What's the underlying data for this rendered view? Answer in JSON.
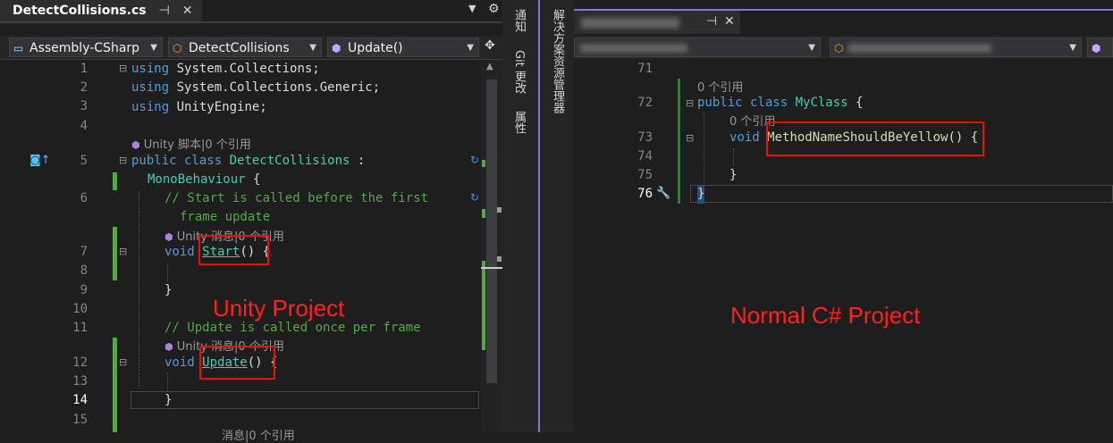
{
  "left_editor": {
    "tab_title": "DetectCollisions.cs",
    "nav": {
      "project": "Assembly-CSharp",
      "class": "DetectCollisions",
      "member": "Update()"
    },
    "line_numbers": [
      "1",
      "2",
      "3",
      "4",
      "5",
      "6",
      "7",
      "8",
      "9",
      "10",
      "11",
      "12",
      "13",
      "14",
      "15"
    ],
    "code": {
      "l1_kw": "using",
      "l1_rest": " System.Collections;",
      "l2_kw": "using",
      "l2_rest": " System.Collections.Generic;",
      "l3_kw": "using",
      "l3_rest": " UnityEngine;",
      "lens_script": "Unity 脚本|0 个引用",
      "l5_public": "public",
      "l5_class": " class ",
      "l5_name": "DetectCollisions",
      "l5_colon": " :",
      "l5b_base": "MonoBehaviour",
      "l5b_brace": " {",
      "l6_comment": "// Start is called before the first",
      "l6b_comment": "frame update",
      "lens_message_1": "Unity 消息|0 个引用",
      "l7_void": "void ",
      "l7_name": "Start",
      "l7_rest": "() {",
      "l9_brace": "}",
      "l11_comment": "// Update is called once per frame",
      "lens_message_2": "Unity 消息|0 个引用",
      "l12_void": "void ",
      "l12_name": "Update",
      "l12_rest": "() {",
      "l14_brace": "}",
      "lens_partial": "消息|0 个引用"
    }
  },
  "annotations": {
    "left_label": "Unity Project",
    "right_label": "Normal C# Project",
    "color": "#ff2020"
  },
  "side_tabs": {
    "notifications": "通知",
    "git_changes": "Git 更改",
    "properties": "属性",
    "solution_explorer": "解决方案资源管理器"
  },
  "right_editor": {
    "line_numbers": [
      "71",
      "72",
      "73",
      "74",
      "75",
      "76"
    ],
    "code": {
      "lens_class": "0 个引用",
      "l72_public": "public",
      "l72_class": " class ",
      "l72_name": "MyClass",
      "l72_brace": " {",
      "lens_method": "0 个引用",
      "l73_void": "void ",
      "l73_name": "MethodNameShouldBeYellow",
      "l73_rest": "() {",
      "l75_brace": "}",
      "l76_brace": "}"
    }
  },
  "colors": {
    "keyword": "#569cd6",
    "type": "#4ec9b0",
    "method": "#dcdcaa",
    "comment": "#57a64a",
    "accent_purple": "#8c74d9"
  }
}
